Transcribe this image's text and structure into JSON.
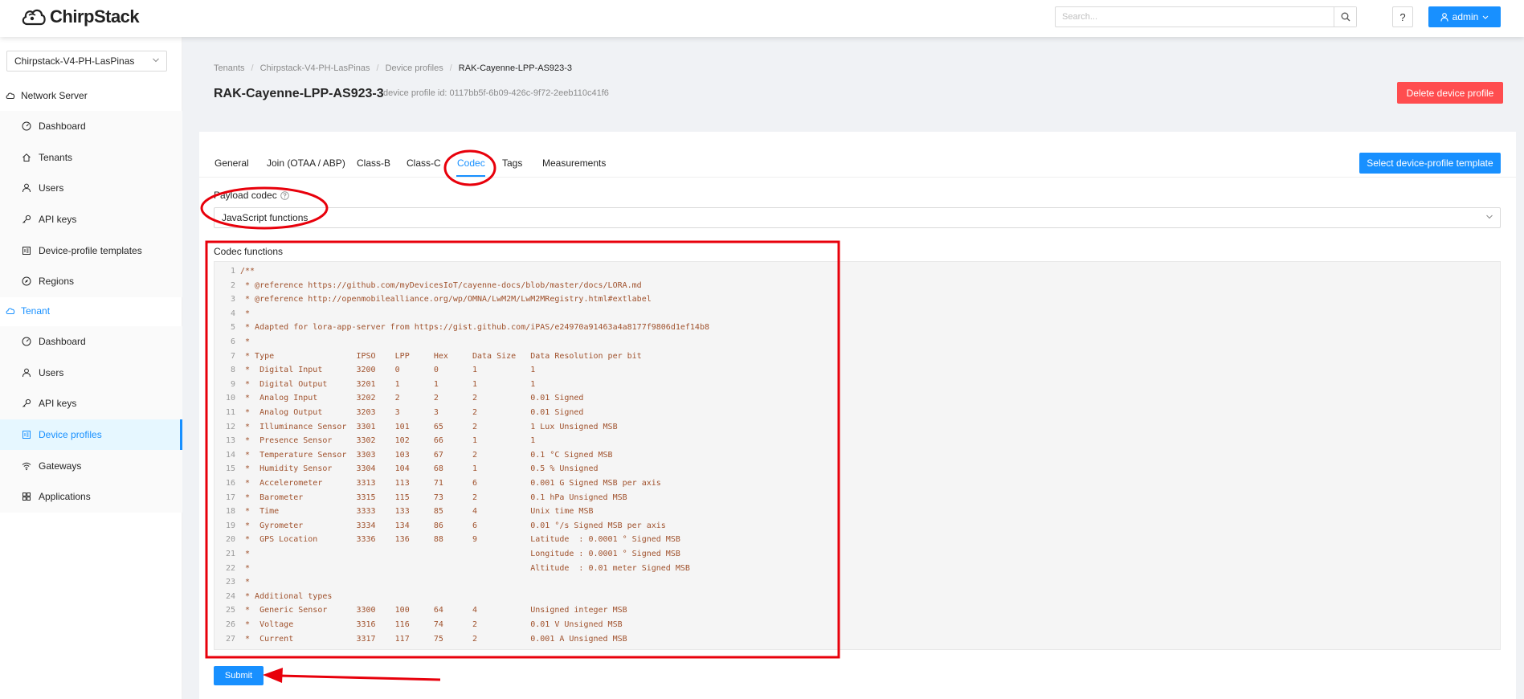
{
  "header": {
    "brand": "ChirpStack",
    "search_placeholder": "Search...",
    "help_label": "?",
    "user_label": "admin"
  },
  "sidebar": {
    "tenant_select": "Chirpstack-V4-PH-LasPinas",
    "network_server": {
      "label": "Network Server",
      "items": [
        {
          "label": "Dashboard",
          "icon": "dashboard-icon"
        },
        {
          "label": "Tenants",
          "icon": "home-icon"
        },
        {
          "label": "Users",
          "icon": "user-icon"
        },
        {
          "label": "API keys",
          "icon": "key-icon"
        },
        {
          "label": "Device-profile templates",
          "icon": "template-icon"
        },
        {
          "label": "Regions",
          "icon": "compass-icon"
        }
      ]
    },
    "tenant": {
      "label": "Tenant",
      "items": [
        {
          "label": "Dashboard",
          "icon": "dashboard-icon"
        },
        {
          "label": "Users",
          "icon": "user-icon"
        },
        {
          "label": "API keys",
          "icon": "key-icon"
        },
        {
          "label": "Device profiles",
          "icon": "template-icon"
        },
        {
          "label": "Gateways",
          "icon": "wifi-icon"
        },
        {
          "label": "Applications",
          "icon": "appstore-icon"
        }
      ]
    }
  },
  "breadcrumb": [
    "Tenants",
    "Chirpstack-V4-PH-LasPinas",
    "Device profiles",
    "RAK-Cayenne-LPP-AS923-3"
  ],
  "page": {
    "title": "RAK-Cayenne-LPP-AS923-3",
    "subtitle": "device profile id: 0117bb5f-6b09-426c-9f72-2eeb110c41f6",
    "delete_label": "Delete device profile"
  },
  "tabs": [
    {
      "label": "General"
    },
    {
      "label": "Join (OTAA / ABP)"
    },
    {
      "label": "Class-B"
    },
    {
      "label": "Class-C"
    },
    {
      "label": "Codec"
    },
    {
      "label": "Tags"
    },
    {
      "label": "Measurements"
    }
  ],
  "active_tab": "Codec",
  "template_button": "Select device-profile template",
  "payload_codec": {
    "label": "Payload codec",
    "value": "JavaScript functions"
  },
  "codec_functions": {
    "label": "Codec functions",
    "lines": [
      "/**",
      " * @reference https://github.com/myDevicesIoT/cayenne-docs/blob/master/docs/LORA.md",
      " * @reference http://openmobilealliance.org/wp/OMNA/LwM2M/LwM2MRegistry.html#extlabel",
      " *",
      " * Adapted for lora-app-server from https://gist.github.com/iPAS/e24970a91463a4a8177f9806d1ef14b8",
      " *",
      " * Type                 IPSO    LPP     Hex     Data Size   Data Resolution per bit",
      " *  Digital Input       3200    0       0       1           1",
      " *  Digital Output      3201    1       1       1           1",
      " *  Analog Input        3202    2       2       2           0.01 Signed",
      " *  Analog Output       3203    3       3       2           0.01 Signed",
      " *  Illuminance Sensor  3301    101     65      2           1 Lux Unsigned MSB",
      " *  Presence Sensor     3302    102     66      1           1",
      " *  Temperature Sensor  3303    103     67      2           0.1 °C Signed MSB",
      " *  Humidity Sensor     3304    104     68      1           0.5 % Unsigned",
      " *  Accelerometer       3313    113     71      6           0.001 G Signed MSB per axis",
      " *  Barometer           3315    115     73      2           0.1 hPa Unsigned MSB",
      " *  Time                3333    133     85      4           Unix time MSB",
      " *  Gyrometer           3334    134     86      6           0.01 °/s Signed MSB per axis",
      " *  GPS Location        3336    136     88      9           Latitude  : 0.0001 ° Signed MSB",
      " *                                                          Longitude : 0.0001 ° Signed MSB",
      " *                                                          Altitude  : 0.01 meter Signed MSB",
      " *",
      " * Additional types",
      " *  Generic Sensor      3300    100     64      4           Unsigned integer MSB",
      " *  Voltage             3316    116     74      2           0.01 V Unsigned MSB",
      " *  Current             3317    117     75      2           0.001 A Unsigned MSB"
    ]
  },
  "submit_label": "Submit",
  "colors": {
    "primary": "#1890ff",
    "danger": "#ff4d4f",
    "annotation": "#e8000b",
    "code_text": "#a0522d"
  }
}
